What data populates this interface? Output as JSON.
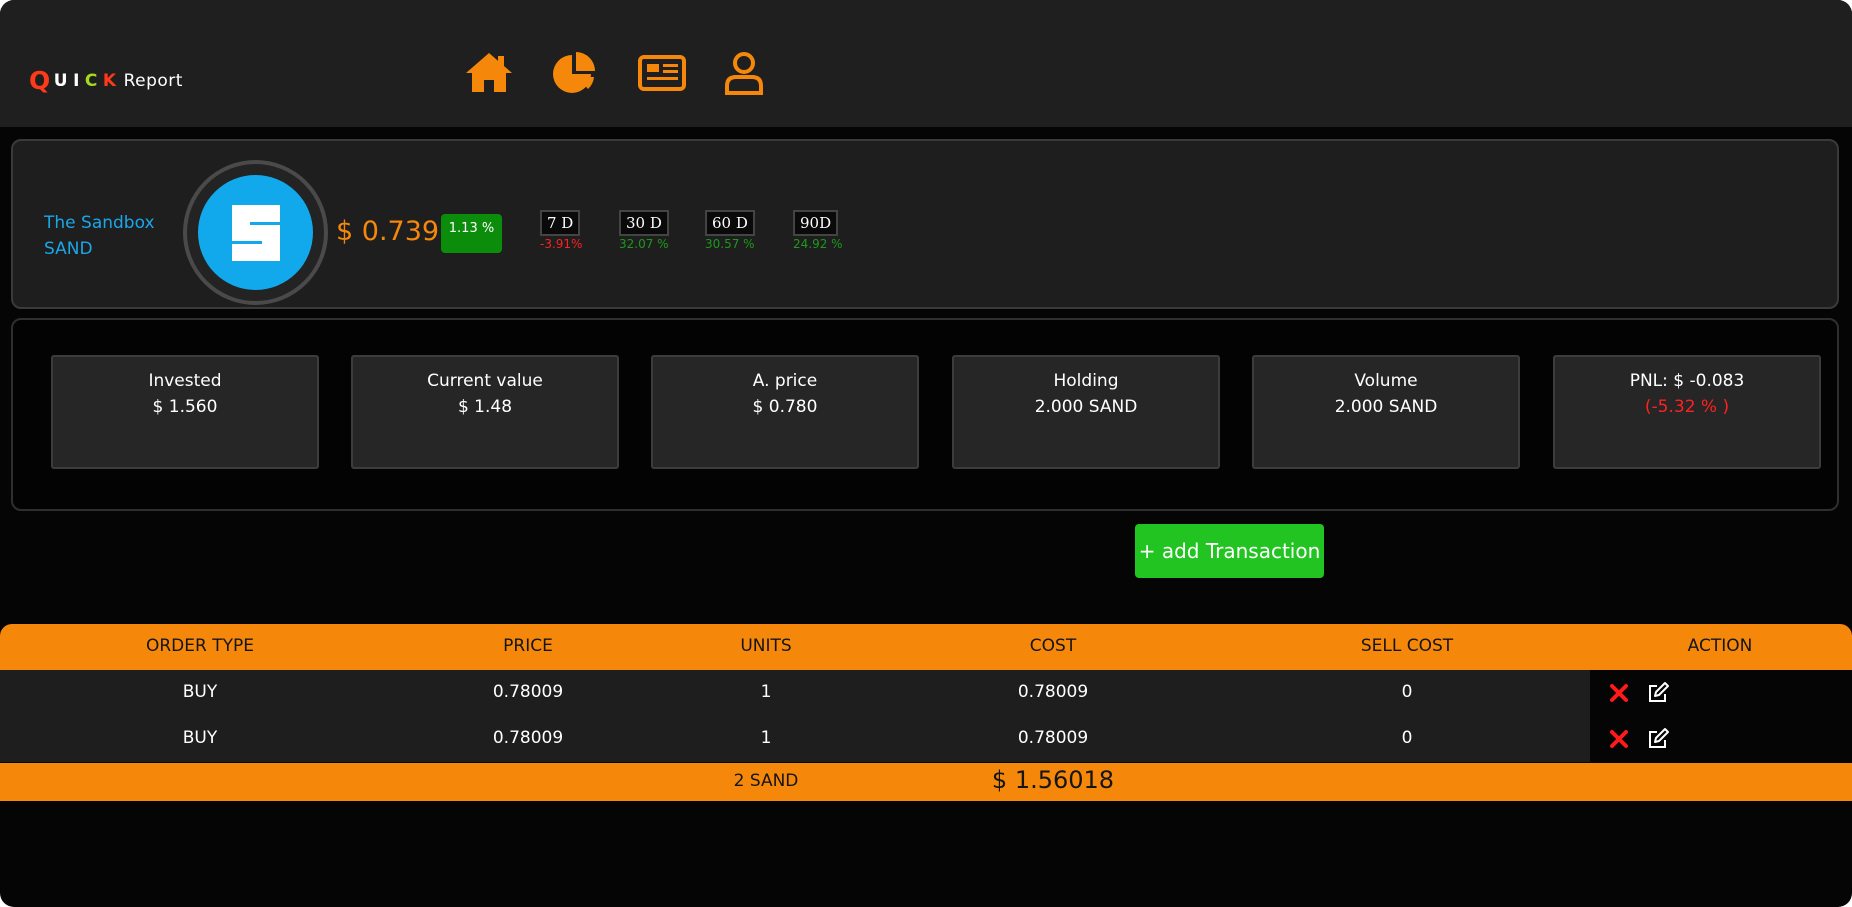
{
  "logo": {
    "letters": [
      "Q",
      "U",
      "I",
      "C",
      "K"
    ],
    "word": "Report",
    "letter_colors": [
      "#ff3a1a",
      "#ffffff",
      "#ffffff",
      "#a8d91c",
      "#ff3a1a"
    ]
  },
  "nav": {
    "icons": [
      "home-icon",
      "pie-chart-icon",
      "newspaper-icon",
      "user-icon"
    ],
    "accent": "#f5880b"
  },
  "coin": {
    "name": "The Sandbox",
    "symbol": "SAND",
    "logo_letter": "S",
    "price": "$ 0.739",
    "change_24h": "1.13 %",
    "periods": [
      {
        "label": "7 D",
        "change": "-3.91%",
        "color": "#ff2020"
      },
      {
        "label": "30 D",
        "change": "32.07 %",
        "color": "#1b9a1b"
      },
      {
        "label": "60 D",
        "change": "30.57 %",
        "color": "#1b9a1b"
      },
      {
        "label": "90D",
        "change": "24.92 %",
        "color": "#1b9a1b"
      }
    ]
  },
  "stats": [
    {
      "label": "Invested",
      "value": "$ 1.560",
      "color": "#ffffff"
    },
    {
      "label": "Current value",
      "value": "$ 1.48",
      "color": "#ffffff"
    },
    {
      "label": "A. price",
      "value": "$ 0.780",
      "color": "#ffffff"
    },
    {
      "label": "Holding",
      "value": "2.000 SAND",
      "color": "#ffffff"
    },
    {
      "label": "Volume",
      "value": "2.000 SAND",
      "color": "#ffffff"
    },
    {
      "label": "PNL: $ -0.083",
      "value": "(-5.32 % )",
      "color": "#ff2020"
    }
  ],
  "add_transaction_label": "+ add Transaction",
  "table": {
    "headers": [
      "ORDER TYPE",
      "PRICE",
      "UNITS",
      "COST",
      "SELL COST",
      "ACTION"
    ],
    "rows": [
      {
        "type": "BUY",
        "price": "0.78009",
        "units": "1",
        "cost": "0.78009",
        "sell_cost": "0"
      },
      {
        "type": "BUY",
        "price": "0.78009",
        "units": "1",
        "cost": "0.78009",
        "sell_cost": "0"
      }
    ],
    "footer": {
      "units": "2 SAND",
      "cost": "$ 1.56018"
    },
    "action_icons": [
      "delete-icon",
      "edit-icon"
    ]
  }
}
